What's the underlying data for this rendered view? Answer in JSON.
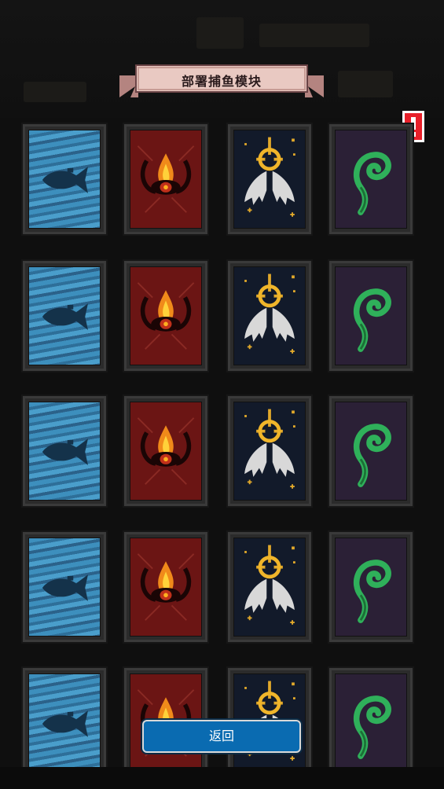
{
  "header": {
    "title": "部署捕鱼模块"
  },
  "alert": {
    "icon": "exclamation-alert-icon",
    "color": "#e8202a"
  },
  "card_types": [
    "water-fish",
    "fire-eye",
    "winged-sun",
    "green-spiral"
  ],
  "grid": {
    "rows": [
      {
        "cards": [
          "water-fish",
          "fire-eye",
          "winged-sun",
          "green-spiral"
        ]
      },
      {
        "cards": [
          "water-fish",
          "fire-eye",
          "winged-sun",
          "green-spiral"
        ]
      },
      {
        "cards": [
          "water-fish",
          "fire-eye",
          "winged-sun",
          "green-spiral"
        ]
      },
      {
        "cards": [
          "water-fish",
          "fire-eye",
          "winged-sun",
          "green-spiral"
        ]
      },
      {
        "cards": [
          "water-fish",
          "fire-eye",
          "winged-sun",
          "green-spiral"
        ]
      }
    ]
  },
  "footer": {
    "back_label": "返回"
  },
  "colors": {
    "button": "#0a6bb1",
    "ribbon": "#e9c9c2",
    "ribbon_edge": "#b48480"
  }
}
